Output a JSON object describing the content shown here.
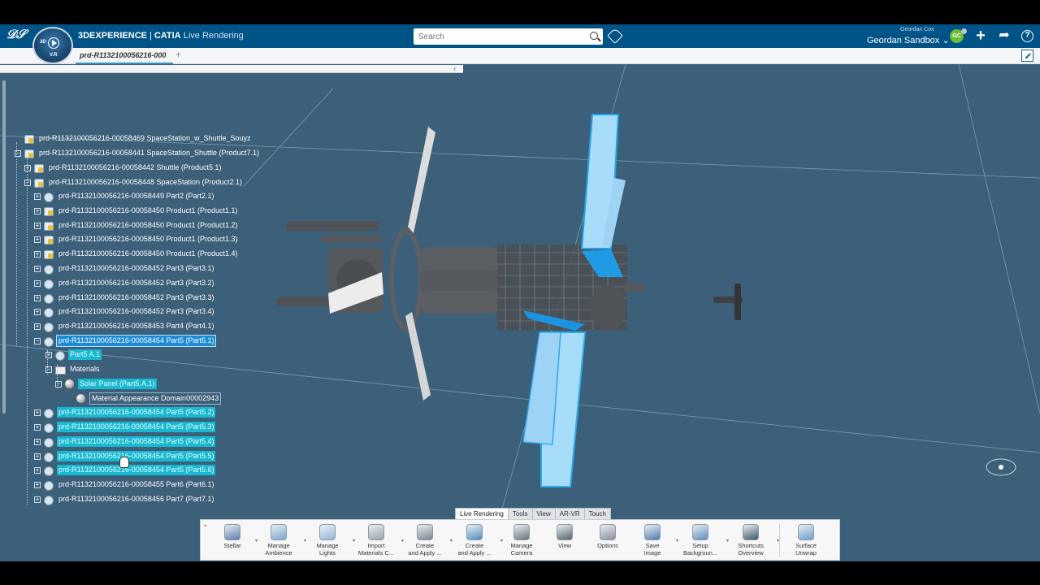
{
  "header": {
    "brand": "3DEXPERIENCE",
    "product": "CATIA",
    "app_name": "Live Rendering",
    "compass_3d": "3D",
    "compass_vr": "V.R",
    "search_placeholder": "Search",
    "user_name": "Geordan Cox",
    "collaborative_space": "Geordan Sandbox",
    "avatar_initials": "GC",
    "colors": {
      "header_bg": "#005386",
      "selection": "#17b8d0",
      "viewport_bg": "#3c5f7a"
    }
  },
  "tabs": {
    "active_tab": "prd-R1132100056216-000",
    "add_label": "+"
  },
  "tree": [
    {
      "label": "prd-R1132100056216-00058469 SpaceStation_w_Shuttle_Souyz",
      "icon": "product-icon",
      "state": "normal"
    },
    {
      "label": "prd-R1132100056216-00058441 SpaceStation_Shuttle (Product7.1)",
      "icon": "product-icon",
      "state": "normal",
      "expander": "−"
    },
    {
      "label": "prd-R1132100056216-00058442 Shuttle (Product5.1)",
      "icon": "product-icon",
      "state": "normal",
      "expander": "+"
    },
    {
      "label": "prd-R1132100056216-00058448 SpaceStation (Product2.1)",
      "icon": "product-icon",
      "state": "normal",
      "expander": "−"
    },
    {
      "label": "prd-R1132100056216-00058449 Part2 (Part2.1)",
      "icon": "part-icon",
      "state": "normal",
      "expander": "+"
    },
    {
      "label": "prd-R1132100056216-00058450 Product1 (Product1.1)",
      "icon": "product-icon",
      "state": "normal",
      "expander": "+"
    },
    {
      "label": "prd-R1132100056216-00058450 Product1 (Product1.2)",
      "icon": "product-icon",
      "state": "normal",
      "expander": "+"
    },
    {
      "label": "prd-R1132100056216-00058450 Product1 (Product1.3)",
      "icon": "product-icon",
      "state": "normal",
      "expander": "+"
    },
    {
      "label": "prd-R1132100056216-00058450 Product1 (Product1.4)",
      "icon": "product-icon",
      "state": "normal",
      "expander": "+"
    },
    {
      "label": "prd-R1132100056216-00058452 Part3 (Part3.1)",
      "icon": "part-icon",
      "state": "normal",
      "expander": "+"
    },
    {
      "label": "prd-R1132100056216-00058452 Part3 (Part3.2)",
      "icon": "part-icon",
      "state": "normal",
      "expander": "+"
    },
    {
      "label": "prd-R1132100056216-00058452 Part3 (Part3.3)",
      "icon": "part-icon",
      "state": "normal",
      "expander": "+"
    },
    {
      "label": "prd-R1132100056216-00058452 Part3 (Part3.4)",
      "icon": "part-icon",
      "state": "normal",
      "expander": "+"
    },
    {
      "label": "prd-R1132100056216-00058453 Part4 (Part4.1)",
      "icon": "part-icon",
      "state": "normal",
      "expander": "+"
    },
    {
      "label": "prd-R1132100056216-00058454 Part5 (Part5.1)",
      "icon": "part-icon",
      "state": "selected",
      "expander": "−"
    },
    {
      "label": "Part5 A.1",
      "icon": "part-icon",
      "state": "highlighted",
      "expander": "+"
    },
    {
      "label": "Materials",
      "icon": "folder-icon",
      "state": "normal",
      "expander": "−"
    },
    {
      "label": "Solar Panel (Part5.A.1)",
      "icon": "material-icon",
      "state": "highlighted",
      "expander": "−"
    },
    {
      "label": "Material Appearance Domain00002943",
      "icon": "material-domain-icon",
      "state": "boxed"
    },
    {
      "label": "prd-R1132100056216-00058454 Part5 (Part5.2)",
      "icon": "part-icon",
      "state": "highlighted",
      "expander": "+"
    },
    {
      "label": "prd-R1132100056216-00058454 Part5 (Part5.3)",
      "icon": "part-icon",
      "state": "highlighted",
      "expander": "+"
    },
    {
      "label": "prd-R1132100056216-00058454 Part5 (Part5.4)",
      "icon": "part-icon",
      "state": "highlighted",
      "expander": "+"
    },
    {
      "label": "prd-R1132100056216-00058454 Part5 (Part5.5)",
      "icon": "part-icon",
      "state": "highlighted",
      "expander": "+"
    },
    {
      "label": "prd-R1132100056216-00058454 Part5 (Part5.6)",
      "icon": "part-icon",
      "state": "highlighted",
      "expander": "+"
    },
    {
      "label": "prd-R1132100056216-00058455 Part6 (Part6.1)",
      "icon": "part-icon",
      "state": "normal",
      "expander": "+"
    },
    {
      "label": "prd-R1132100056216-00058456 Part7 (Part7.1)",
      "icon": "part-icon",
      "state": "normal",
      "expander": "+"
    }
  ],
  "section_tabs": [
    "Live Rendering",
    "Tools",
    "View",
    "AR-VR",
    "Touch"
  ],
  "actions": [
    {
      "label": "Stellar",
      "icon": "stellar-icon",
      "dropdown": true
    },
    {
      "label": "Manage\nAmbience",
      "icon": "ambience-icon",
      "dropdown": true
    },
    {
      "label": "Manage\nLights",
      "icon": "lights-icon",
      "dropdown": true
    },
    {
      "label": "Import\nMaterials C...",
      "icon": "import-materials-icon",
      "dropdown": true
    },
    {
      "label": "Create\nand Apply ...",
      "icon": "create-apply-material-icon",
      "dropdown": true
    },
    {
      "label": "Create\nand Apply ...",
      "icon": "create-apply-sticker-icon",
      "dropdown": true
    },
    {
      "label": "Manage\nCamera",
      "icon": "camera-icon",
      "dropdown": false
    },
    {
      "label": "View",
      "icon": "view-icon",
      "dropdown": false
    },
    {
      "label": "Options",
      "icon": "options-gear-icon",
      "dropdown": false
    },
    {
      "label": "Save\nImage",
      "icon": "save-image-icon",
      "dropdown": true
    },
    {
      "label": "Setup\nBackgroun...",
      "icon": "background-icon",
      "dropdown": true
    },
    {
      "label": "Shortcuts\nOverview",
      "icon": "help-icon",
      "dropdown": true
    },
    {
      "label": "Surface\nUnwrap",
      "icon": "unwrap-icon",
      "dropdown": false
    }
  ]
}
